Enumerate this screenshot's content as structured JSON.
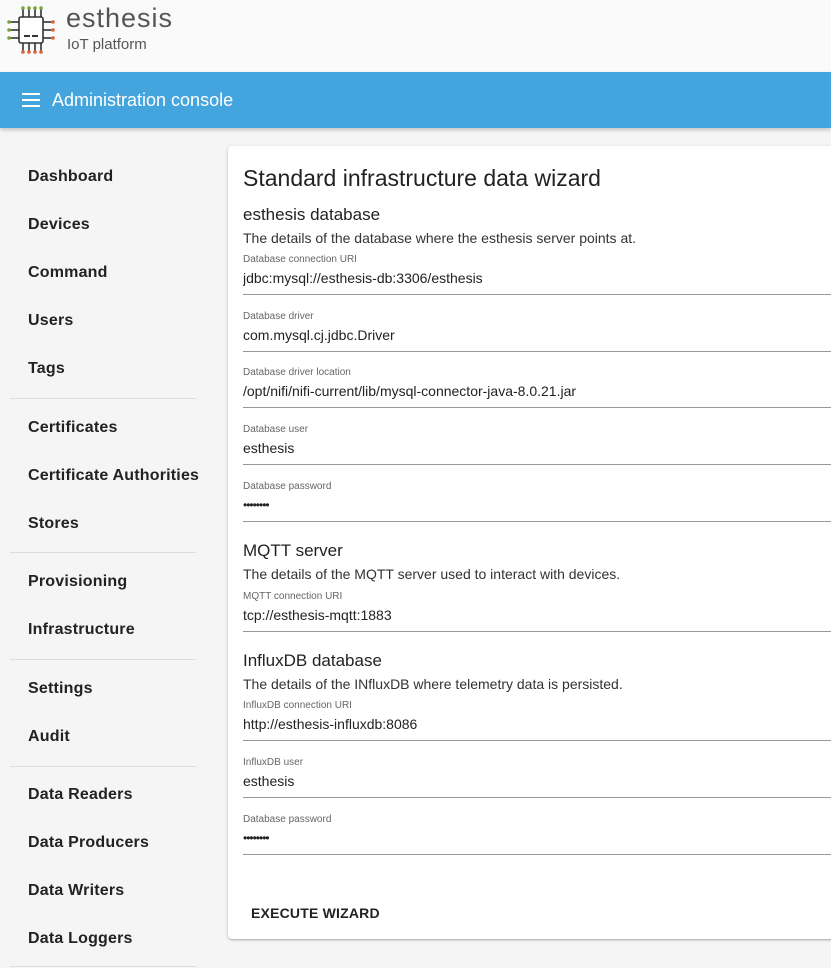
{
  "brand": {
    "name": "esthesis",
    "tagline": "IoT platform"
  },
  "toolbar": {
    "title": "Administration console"
  },
  "sidebar": {
    "items": [
      {
        "label": "Dashboard"
      },
      {
        "label": "Devices"
      },
      {
        "label": "Command"
      },
      {
        "label": "Users"
      },
      {
        "label": "Tags"
      },
      {
        "label": "Certificates"
      },
      {
        "label": "Certificate Authorities"
      },
      {
        "label": "Stores"
      },
      {
        "label": "Provisioning"
      },
      {
        "label": "Infrastructure"
      },
      {
        "label": "Settings"
      },
      {
        "label": "Audit"
      },
      {
        "label": "Data Readers"
      },
      {
        "label": "Data Producers"
      },
      {
        "label": "Data Writers"
      },
      {
        "label": "Data Loggers"
      }
    ]
  },
  "wizard": {
    "title": "Standard infrastructure data wizard",
    "db": {
      "title": "esthesis database",
      "desc": "The details of the database where the esthesis server points at.",
      "uri_label": "Database connection URI",
      "uri_value": "jdbc:mysql://esthesis-db:3306/esthesis",
      "driver_label": "Database driver",
      "driver_value": "com.mysql.cj.jdbc.Driver",
      "driver_location_label": "Database driver location",
      "driver_location_value": "/opt/nifi/nifi-current/lib/mysql-connector-java-8.0.21.jar",
      "user_label": "Database user",
      "user_value": "esthesis",
      "password_label": "Database password",
      "password_value": "esthesis"
    },
    "mqtt": {
      "title": "MQTT server",
      "desc": "The details of the MQTT server used to interact with devices.",
      "uri_label": "MQTT connection URI",
      "uri_value": "tcp://esthesis-mqtt:1883"
    },
    "influx": {
      "title": "InfluxDB database",
      "desc": "The details of the INfluxDB where telemetry data is persisted.",
      "uri_label": "InfluxDB connection URI",
      "uri_value": "http://esthesis-influxdb:8086",
      "user_label": "InfluxDB user",
      "user_value": "esthesis",
      "password_label": "Database password",
      "password_value": "esthesis"
    },
    "execute_label": "EXECUTE WIZARD"
  }
}
